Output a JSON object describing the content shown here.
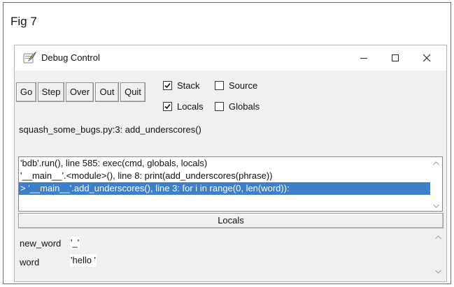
{
  "figure": {
    "label": "Fig 7"
  },
  "window": {
    "title": "Debug Control",
    "controls": {
      "minimize": "minimize",
      "maximize": "maximize",
      "close": "close"
    }
  },
  "toolbar": {
    "buttons": [
      "Go",
      "Step",
      "Over",
      "Out",
      "Quit"
    ]
  },
  "options": {
    "stack": {
      "label": "Stack",
      "checked": true
    },
    "source": {
      "label": "Source",
      "checked": false
    },
    "locals": {
      "label": "Locals",
      "checked": true
    },
    "globals": {
      "label": "Globals",
      "checked": false
    }
  },
  "status": {
    "text": "squash_some_bugs.py:3: add_underscores()"
  },
  "stack": {
    "frames": [
      "'bdb'.run(), line 585: exec(cmd, globals, locals)",
      "'__main__'.<module>(), line 8: print(add_underscores(phrase))",
      "> '__main__'.add_underscores(), line 3: for i in range(0, len(word)):"
    ],
    "selected_index": 2
  },
  "locals": {
    "header": "Locals",
    "variables": [
      {
        "name": "new_word",
        "value": "'_'"
      },
      {
        "name": "word",
        "value": "'hello '"
      }
    ]
  },
  "colors": {
    "selection": "#3f7ec8",
    "window_bg": "#f0f0f0",
    "title_bg": "#ffffff"
  }
}
